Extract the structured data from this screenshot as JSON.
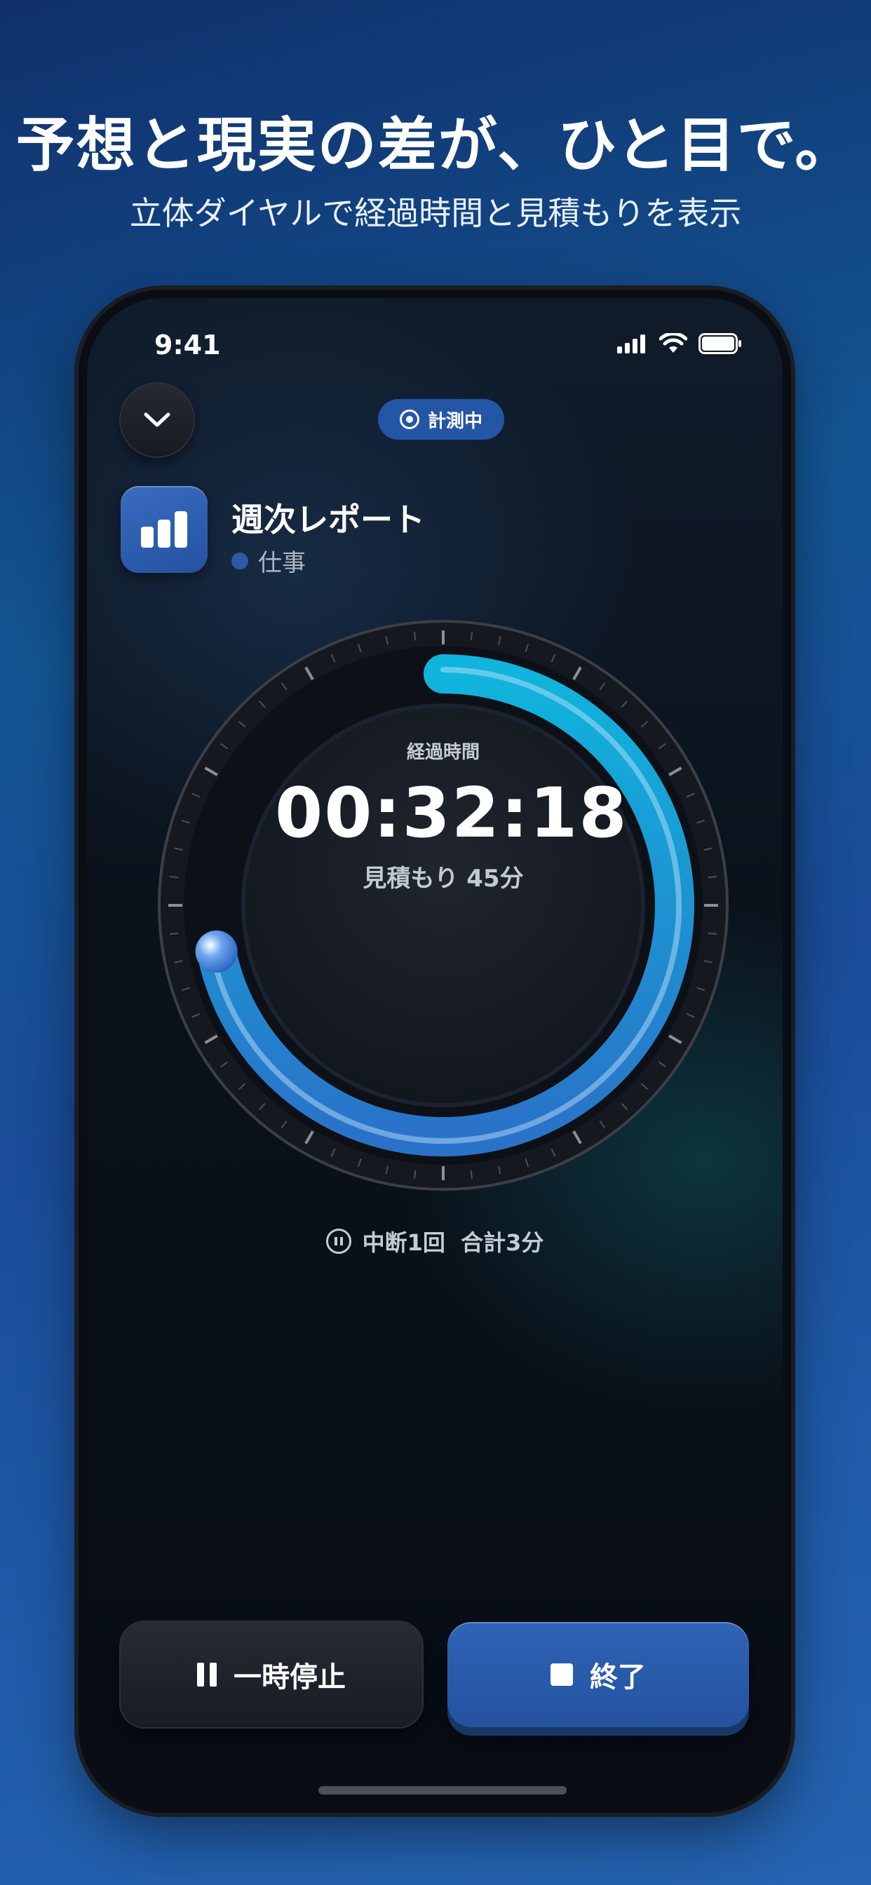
{
  "promo": {
    "headline": "予想と現実の差が、ひと目で。",
    "subheadline": "立体ダイヤルで経過時間と見積もりを表示"
  },
  "status_bar": {
    "time": "9:41"
  },
  "header": {
    "status_label": "計測中"
  },
  "task": {
    "title": "週次レポート",
    "category": "仕事",
    "category_color": "#2a5aa8"
  },
  "timer": {
    "elapsed_label": "経過時間",
    "elapsed_time": "00:32:18",
    "estimate_text": "見積もり 45分",
    "progress_fraction": 0.718
  },
  "interruptions": {
    "text": "中断1回  合計3分"
  },
  "actions": {
    "pause_label": "一時停止",
    "end_label": "終了"
  },
  "colors": {
    "accent": "#1ea0e0",
    "primary_button": "#2a5aa8"
  }
}
